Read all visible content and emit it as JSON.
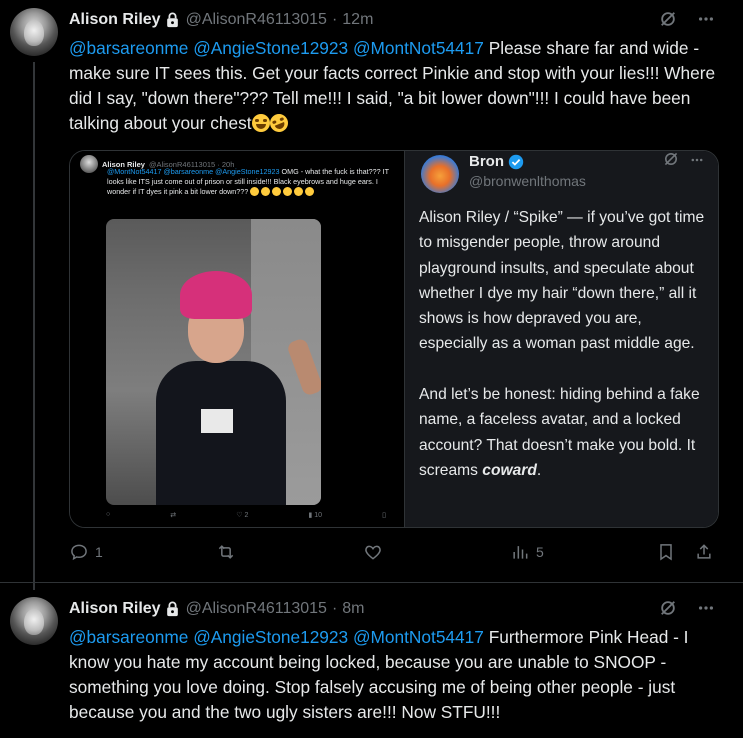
{
  "tweet1": {
    "name": "Alison Riley",
    "handle": "@AlisonR46113015",
    "dot": "·",
    "time": "12m",
    "mentions": [
      "@barsareonme",
      "@AngieStone12923",
      "@MontNot54417"
    ],
    "text": "Please share far and wide - make sure IT sees this.  Get your facts correct Pinkie and stop with your lies!!!  Where did I say, \"down there\"???  Tell me!!!  I said, \"a bit lower down\"!!!  I could have been talking about your chest",
    "actions": {
      "replies": "1",
      "views": "5"
    }
  },
  "embedded_left": {
    "name": "Alison Riley",
    "handle": "@AlisonR46113015 · 20h",
    "mentions": "@MontNot54417 @barsareonme @AngieStone12923",
    "text": "OMG - what the fuck is that??? IT looks like ITS just come out of prison or still inside!!! Black eyebrows and huge ears.  I wonder if IT dyes it pink a bit lower down???",
    "actions": {
      "likes": "2",
      "views": "10"
    }
  },
  "embedded_right": {
    "name": "Bron",
    "handle": "@bronwenlthomas",
    "text_p1": "Alison Riley / “Spike” — if you’ve got time to misgender people, throw around playground insults, and speculate about whether I dye my hair “down there,” all it shows is how depraved you are,  especially as a woman past middle age.",
    "text_p2a": "And let’s be honest: hiding behind a fake name, a faceless avatar, and a locked account? That doesn’t make you bold. It screams ",
    "text_p2b": "coward",
    "text_p2c": "."
  },
  "tweet2": {
    "name": "Alison Riley",
    "handle": "@AlisonR46113015",
    "dot": "·",
    "time": "8m",
    "mentions": [
      "@barsareonme",
      "@AngieStone12923",
      "@MontNot54417"
    ],
    "text": "Furthermore Pink Head - I know you hate my account being locked, because you are unable to SNOOP - something you love doing.  Stop falsely accusing me of being other people - just because you and the two ugly sisters are!!!  Now STFU!!!"
  },
  "colors": {
    "accent": "#1d9bf0",
    "muted": "#71767b",
    "text": "#e7e9ea",
    "background": "#000000"
  }
}
